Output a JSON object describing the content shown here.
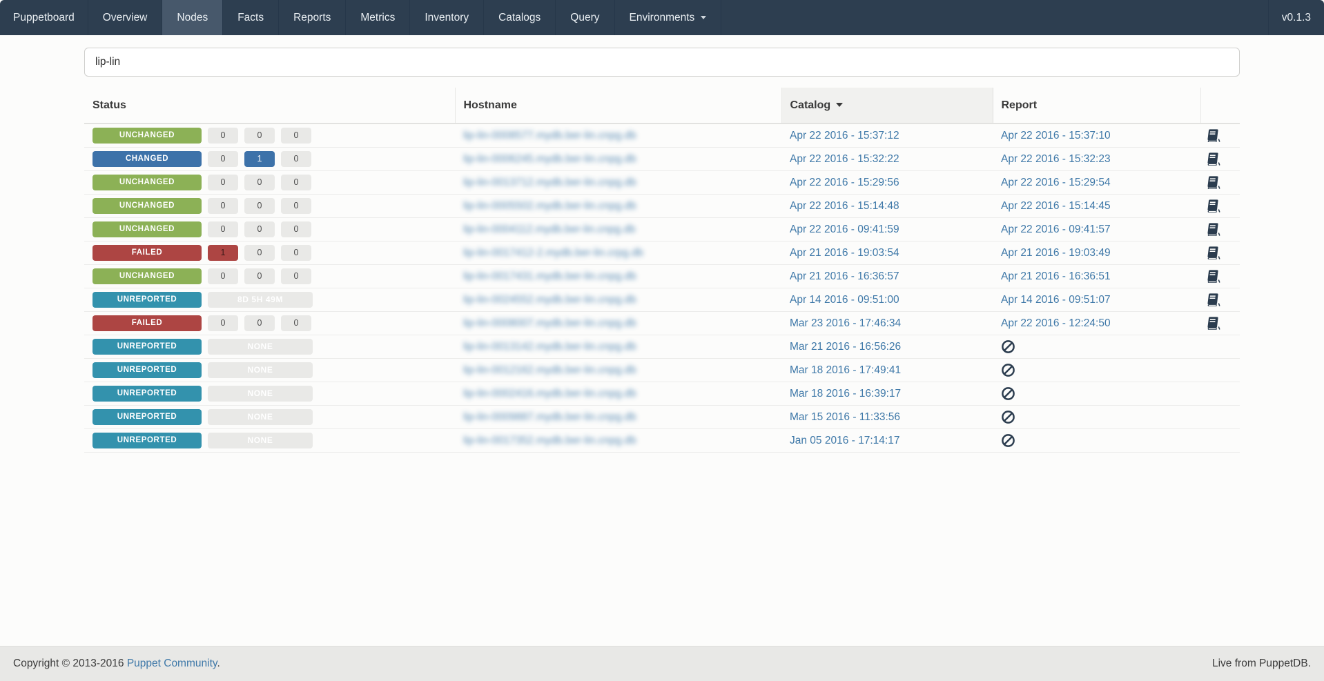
{
  "navbar": {
    "brand": "Puppetboard",
    "items": [
      {
        "label": "Overview",
        "active": false,
        "dropdown": false
      },
      {
        "label": "Nodes",
        "active": true,
        "dropdown": false
      },
      {
        "label": "Facts",
        "active": false,
        "dropdown": false
      },
      {
        "label": "Reports",
        "active": false,
        "dropdown": false
      },
      {
        "label": "Metrics",
        "active": false,
        "dropdown": false
      },
      {
        "label": "Inventory",
        "active": false,
        "dropdown": false
      },
      {
        "label": "Catalogs",
        "active": false,
        "dropdown": false
      },
      {
        "label": "Query",
        "active": false,
        "dropdown": false
      },
      {
        "label": "Environments",
        "active": false,
        "dropdown": true
      }
    ],
    "version": "v0.1.3"
  },
  "search": {
    "value": "lip-lin"
  },
  "colors": {
    "navbar_bg": "#2d3e50",
    "navbar_active_bg": "#47586b",
    "status_unchanged": "#8cb156",
    "status_changed": "#3d72a9",
    "status_failed": "#ad4543",
    "status_unreported": "#3392ad",
    "link_blue": "#3e78a8",
    "footer_bg": "#e8e8e6"
  },
  "table": {
    "columns": [
      {
        "label": "Status"
      },
      {
        "label": "Hostname"
      },
      {
        "label": "Catalog",
        "sorted": "desc"
      },
      {
        "label": "Report"
      }
    ],
    "hostname_redacted": true,
    "rows": [
      {
        "status": "UNCHANGED",
        "status_type": "unchanged",
        "counters": [
          {
            "v": "0"
          },
          {
            "v": "0"
          },
          {
            "v": "0"
          }
        ],
        "hostname": "lip-lin-0008577.mydb.ber-lin.cnpg.db",
        "catalog": "Apr 22 2016 - 15:37:12",
        "report": "Apr 22 2016 - 15:37:10",
        "report_icon": "book"
      },
      {
        "status": "CHANGED",
        "status_type": "changed",
        "counters": [
          {
            "v": "0"
          },
          {
            "v": "1",
            "s": "changed"
          },
          {
            "v": "0"
          }
        ],
        "hostname": "lip-lin-0006245.mydb.ber-lin.cnpg.db",
        "catalog": "Apr 22 2016 - 15:32:22",
        "report": "Apr 22 2016 - 15:32:23",
        "report_icon": "book"
      },
      {
        "status": "UNCHANGED",
        "status_type": "unchanged",
        "counters": [
          {
            "v": "0"
          },
          {
            "v": "0"
          },
          {
            "v": "0"
          }
        ],
        "hostname": "lip-lin-0013712.mydb.ber-lin.cnpg.db",
        "catalog": "Apr 22 2016 - 15:29:56",
        "report": "Apr 22 2016 - 15:29:54",
        "report_icon": "book"
      },
      {
        "status": "UNCHANGED",
        "status_type": "unchanged",
        "counters": [
          {
            "v": "0"
          },
          {
            "v": "0"
          },
          {
            "v": "0"
          }
        ],
        "hostname": "lip-lin-0005502.mydb.ber-lin.cnpg.db",
        "catalog": "Apr 22 2016 - 15:14:48",
        "report": "Apr 22 2016 - 15:14:45",
        "report_icon": "book"
      },
      {
        "status": "UNCHANGED",
        "status_type": "unchanged",
        "counters": [
          {
            "v": "0"
          },
          {
            "v": "0"
          },
          {
            "v": "0"
          }
        ],
        "hostname": "lip-lin-0004112.mydb.ber-lin.cnpg.db",
        "catalog": "Apr 22 2016 - 09:41:59",
        "report": "Apr 22 2016 - 09:41:57",
        "report_icon": "book"
      },
      {
        "status": "FAILED",
        "status_type": "failed",
        "counters": [
          {
            "v": "1",
            "s": "failed"
          },
          {
            "v": "0"
          },
          {
            "v": "0"
          }
        ],
        "hostname": "lip-lin-0017412-2.mydb.ber-lin.crpg.db",
        "catalog": "Apr 21 2016 - 19:03:54",
        "report": "Apr 21 2016 - 19:03:49",
        "report_icon": "book"
      },
      {
        "status": "UNCHANGED",
        "status_type": "unchanged",
        "counters": [
          {
            "v": "0"
          },
          {
            "v": "0"
          },
          {
            "v": "0"
          }
        ],
        "hostname": "lip-lin-0017431.mydb.ber-lin.cnpg.db",
        "catalog": "Apr 21 2016 - 16:36:57",
        "report": "Apr 21 2016 - 16:36:51",
        "report_icon": "book"
      },
      {
        "status": "UNREPORTED",
        "status_type": "unreported",
        "pill": "8D 5H 49M",
        "hostname": "lip-lin-0024552.mydb.ber-lin.cnpg.db",
        "catalog": "Apr 14 2016 - 09:51:00",
        "report": "Apr 14 2016 - 09:51:07",
        "report_icon": "book"
      },
      {
        "status": "FAILED",
        "status_type": "failed",
        "counters": [
          {
            "v": "0"
          },
          {
            "v": "0"
          },
          {
            "v": "0"
          }
        ],
        "hostname": "lip-lin-0008007.mydb.ber-lin.cnpg.db",
        "catalog": "Mar 23 2016 - 17:46:34",
        "report": "Apr 22 2016 - 12:24:50",
        "report_icon": "book"
      },
      {
        "status": "UNREPORTED",
        "status_type": "unreported",
        "pill": "NONE",
        "hostname": "lip-lin-0013142.mydb.ber-lin.cnpg.db",
        "catalog": "Mar 21 2016 - 16:56:26",
        "report": null,
        "report_icon": "ban"
      },
      {
        "status": "UNREPORTED",
        "status_type": "unreported",
        "pill": "NONE",
        "hostname": "lip-lin-0012162.mydb.ber-lin.cnpg.db",
        "catalog": "Mar 18 2016 - 17:49:41",
        "report": null,
        "report_icon": "ban"
      },
      {
        "status": "UNREPORTED",
        "status_type": "unreported",
        "pill": "NONE",
        "hostname": "lip-lin-0002416.mydb.ber-lin.cnpg.db",
        "catalog": "Mar 18 2016 - 16:39:17",
        "report": null,
        "report_icon": "ban"
      },
      {
        "status": "UNREPORTED",
        "status_type": "unreported",
        "pill": "NONE",
        "hostname": "lip-lin-0009887.mydb.ber-lin.cnpg.db",
        "catalog": "Mar 15 2016 - 11:33:56",
        "report": null,
        "report_icon": "ban"
      },
      {
        "status": "UNREPORTED",
        "status_type": "unreported",
        "pill": "NONE",
        "hostname": "lip-lin-0017352.mydb.ber-lin.cnpg.db",
        "catalog": "Jan 05 2016 - 17:14:17",
        "report": null,
        "report_icon": "ban"
      }
    ]
  },
  "footer": {
    "copyright_prefix": "Copyright © 2013-2016 ",
    "copyright_link": "Puppet Community",
    "copyright_suffix": ".",
    "right_text": "Live from PuppetDB."
  }
}
